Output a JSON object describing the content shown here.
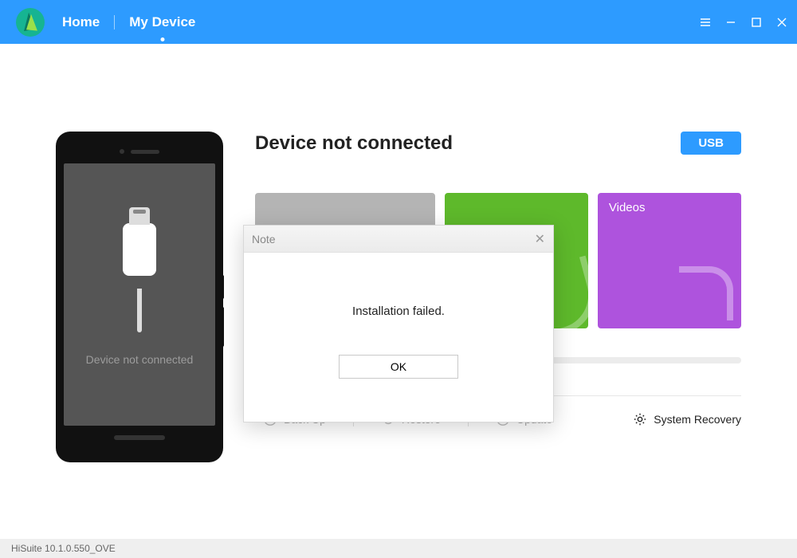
{
  "nav": {
    "home": "Home",
    "my_device": "My Device"
  },
  "phone": {
    "status_text": "Device not connected"
  },
  "content": {
    "heading": "Device not connected",
    "usb_button": "USB",
    "tiles": {
      "pics": "",
      "apps": "",
      "vids": "Videos"
    }
  },
  "actions": {
    "backup": "Back Up",
    "restore": "Restore",
    "update": "Update",
    "recovery": "System Recovery"
  },
  "modal": {
    "title": "Note",
    "message": "Installation failed.",
    "ok": "OK"
  },
  "statusbar": {
    "text": "HiSuite 10.1.0.550_OVE"
  }
}
